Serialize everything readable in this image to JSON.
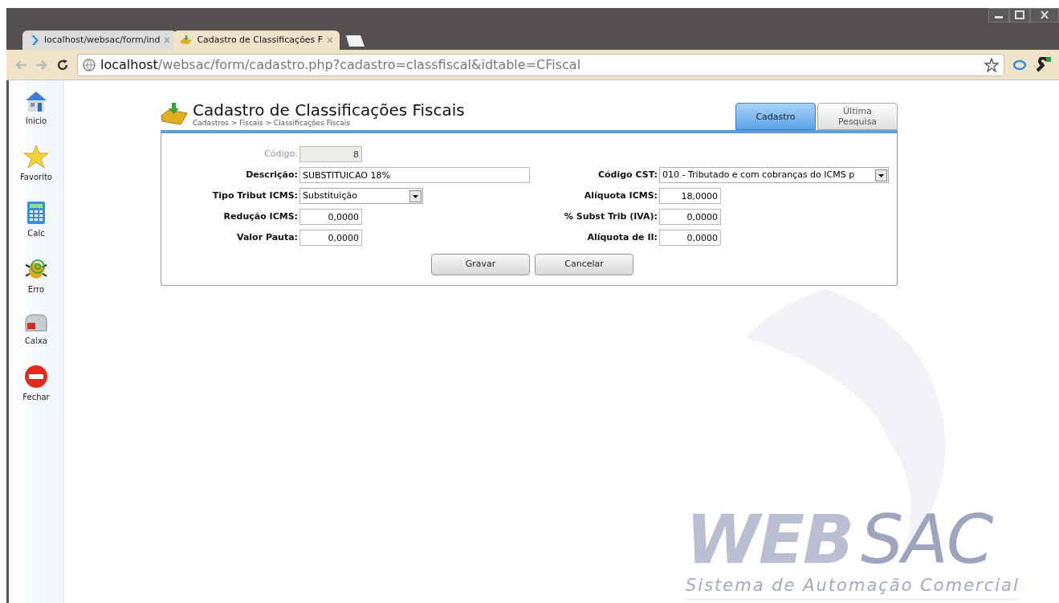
{
  "browser": {
    "tabs": [
      {
        "title": "localhost/websac/form/ind",
        "kind": "websac",
        "selected": false
      },
      {
        "title": "Cadastro de Classificações F",
        "kind": "inbox",
        "selected": true
      }
    ],
    "url_host": "localhost",
    "url_path": "/websac/form/cadastro.php?cadastro=classfiscal&idtable=CFiscal"
  },
  "sidebar": {
    "items": [
      {
        "label": "Inicio",
        "kind": "home"
      },
      {
        "label": "Favorito",
        "kind": "star"
      },
      {
        "label": "Calc",
        "kind": "calc"
      },
      {
        "label": "Erro",
        "kind": "bug"
      },
      {
        "label": "Caixa",
        "kind": "mailbox"
      },
      {
        "label": "Fechar",
        "kind": "close"
      }
    ]
  },
  "form": {
    "title": "Cadastro de Classificações Fiscais",
    "breadcrumb": "Cadastros > Fiscais > Classificações Fiscais",
    "tabs": [
      {
        "label": "Cadastro",
        "selected": true
      },
      {
        "label": "Última Pesquisa",
        "selected": false
      }
    ],
    "rows": [
      {
        "left": {
          "label": "Código:",
          "value": "8",
          "kind": "number",
          "disabled": true
        }
      },
      {
        "left": {
          "label": "Descrição:",
          "value": "SUBSTITUICAO 18%",
          "kind": "text",
          "disabled": false
        },
        "right": {
          "label": "Código CST:",
          "value": "010 - Tributado e com cobranças do ICMS p",
          "kind": "select",
          "disabled": false
        }
      },
      {
        "left": {
          "label": "Tipo Tribut ICMS:",
          "value": "Substituição",
          "kind": "select",
          "disabled": false
        },
        "right": {
          "label": "Alíquota ICMS:",
          "value": "18,0000",
          "kind": "number",
          "disabled": false
        }
      },
      {
        "left": {
          "label": "Redução ICMS:",
          "value": "0,0000",
          "kind": "number",
          "disabled": false
        },
        "right": {
          "label": "% Subst Trib (IVA):",
          "value": "0,0000",
          "kind": "number",
          "disabled": false
        }
      },
      {
        "left": {
          "label": "Valor Pauta:",
          "value": "0,0000",
          "kind": "number",
          "disabled": false
        },
        "right": {
          "label": "Alíquota de II:",
          "value": "0,0000",
          "kind": "number",
          "disabled": false
        }
      }
    ],
    "buttons": [
      "Gravar",
      "Cancelar"
    ]
  },
  "background_logo": {
    "wordmark_bold": "WEB",
    "wordmark_light": "SAC",
    "tagline": "Sistema de Automação Comercial"
  }
}
